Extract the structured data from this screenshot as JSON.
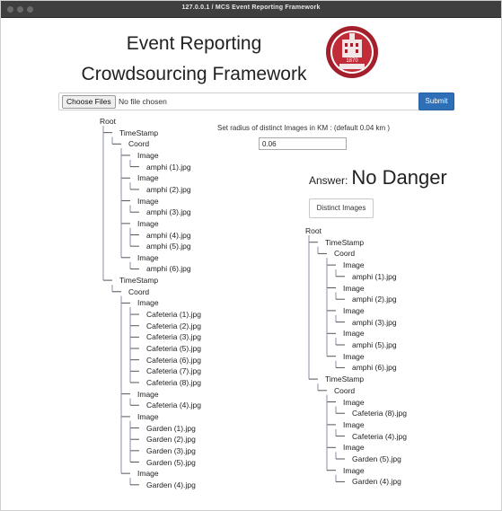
{
  "window": {
    "title": "127.0.0.1 / MCS Event Reporting Framework"
  },
  "header": {
    "title_line1": "Event Reporting",
    "title_line2": "Crowdsourcing Framework",
    "logo_year": "1870"
  },
  "upload": {
    "choose_label": "Choose Files",
    "no_file_text": "No file chosen",
    "submit_label": "Submit"
  },
  "radius": {
    "label": "Set radius of distinct Images in KM : (default 0.04 km )",
    "value": "0.06"
  },
  "answer": {
    "label": "Answer:",
    "value": "No Danger"
  },
  "distinct_button_label": "Distinct Images",
  "left_tree": [
    {
      "t": "Root",
      "d": 0
    },
    {
      "t": "TimeStamp",
      "d": 1
    },
    {
      "t": "Coord",
      "d": 2
    },
    {
      "t": "Image",
      "d": 3
    },
    {
      "t": "amphi (1).jpg",
      "d": 4
    },
    {
      "t": "Image",
      "d": 3
    },
    {
      "t": "amphi (2).jpg",
      "d": 4
    },
    {
      "t": "Image",
      "d": 3
    },
    {
      "t": "amphi (3).jpg",
      "d": 4
    },
    {
      "t": "Image",
      "d": 3
    },
    {
      "t": "amphi (4).jpg",
      "d": 4
    },
    {
      "t": "amphi (5).jpg",
      "d": 4
    },
    {
      "t": "Image",
      "d": 3
    },
    {
      "t": "amphi (6).jpg",
      "d": 4
    },
    {
      "t": "TimeStamp",
      "d": 1
    },
    {
      "t": "Coord",
      "d": 2
    },
    {
      "t": "Image",
      "d": 3
    },
    {
      "t": "Cafeteria (1).jpg",
      "d": 4
    },
    {
      "t": "Cafeteria (2).jpg",
      "d": 4
    },
    {
      "t": "Cafeteria (3).jpg",
      "d": 4
    },
    {
      "t": "Cafeteria (5).jpg",
      "d": 4
    },
    {
      "t": "Cafeteria (6).jpg",
      "d": 4
    },
    {
      "t": "Cafeteria (7).jpg",
      "d": 4
    },
    {
      "t": "Cafeteria (8).jpg",
      "d": 4
    },
    {
      "t": "Image",
      "d": 3
    },
    {
      "t": "Cafeteria (4).jpg",
      "d": 4
    },
    {
      "t": "Image",
      "d": 3
    },
    {
      "t": "Garden (1).jpg",
      "d": 4
    },
    {
      "t": "Garden (2).jpg",
      "d": 4
    },
    {
      "t": "Garden (3).jpg",
      "d": 4
    },
    {
      "t": "Garden (5).jpg",
      "d": 4
    },
    {
      "t": "Image",
      "d": 3
    },
    {
      "t": "Garden (4).jpg",
      "d": 4
    }
  ],
  "right_tree": [
    {
      "t": "Root",
      "d": 0
    },
    {
      "t": "TimeStamp",
      "d": 1
    },
    {
      "t": "Coord",
      "d": 2
    },
    {
      "t": "Image",
      "d": 3
    },
    {
      "t": "amphi (1).jpg",
      "d": 4
    },
    {
      "t": "Image",
      "d": 3
    },
    {
      "t": "amphi (2).jpg",
      "d": 4
    },
    {
      "t": "Image",
      "d": 3
    },
    {
      "t": "amphi (3).jpg",
      "d": 4
    },
    {
      "t": "Image",
      "d": 3
    },
    {
      "t": "amphi (5).jpg",
      "d": 4
    },
    {
      "t": "Image",
      "d": 3
    },
    {
      "t": "amphi (6).jpg",
      "d": 4
    },
    {
      "t": "TimeStamp",
      "d": 1
    },
    {
      "t": "Coord",
      "d": 2
    },
    {
      "t": "Image",
      "d": 3
    },
    {
      "t": "Cafeteria (8).jpg",
      "d": 4
    },
    {
      "t": "Image",
      "d": 3
    },
    {
      "t": "Cafeteria (4).jpg",
      "d": 4
    },
    {
      "t": "Image",
      "d": 3
    },
    {
      "t": "Garden (5).jpg",
      "d": 4
    },
    {
      "t": "Image",
      "d": 3
    },
    {
      "t": "Garden (4).jpg",
      "d": 4
    }
  ]
}
